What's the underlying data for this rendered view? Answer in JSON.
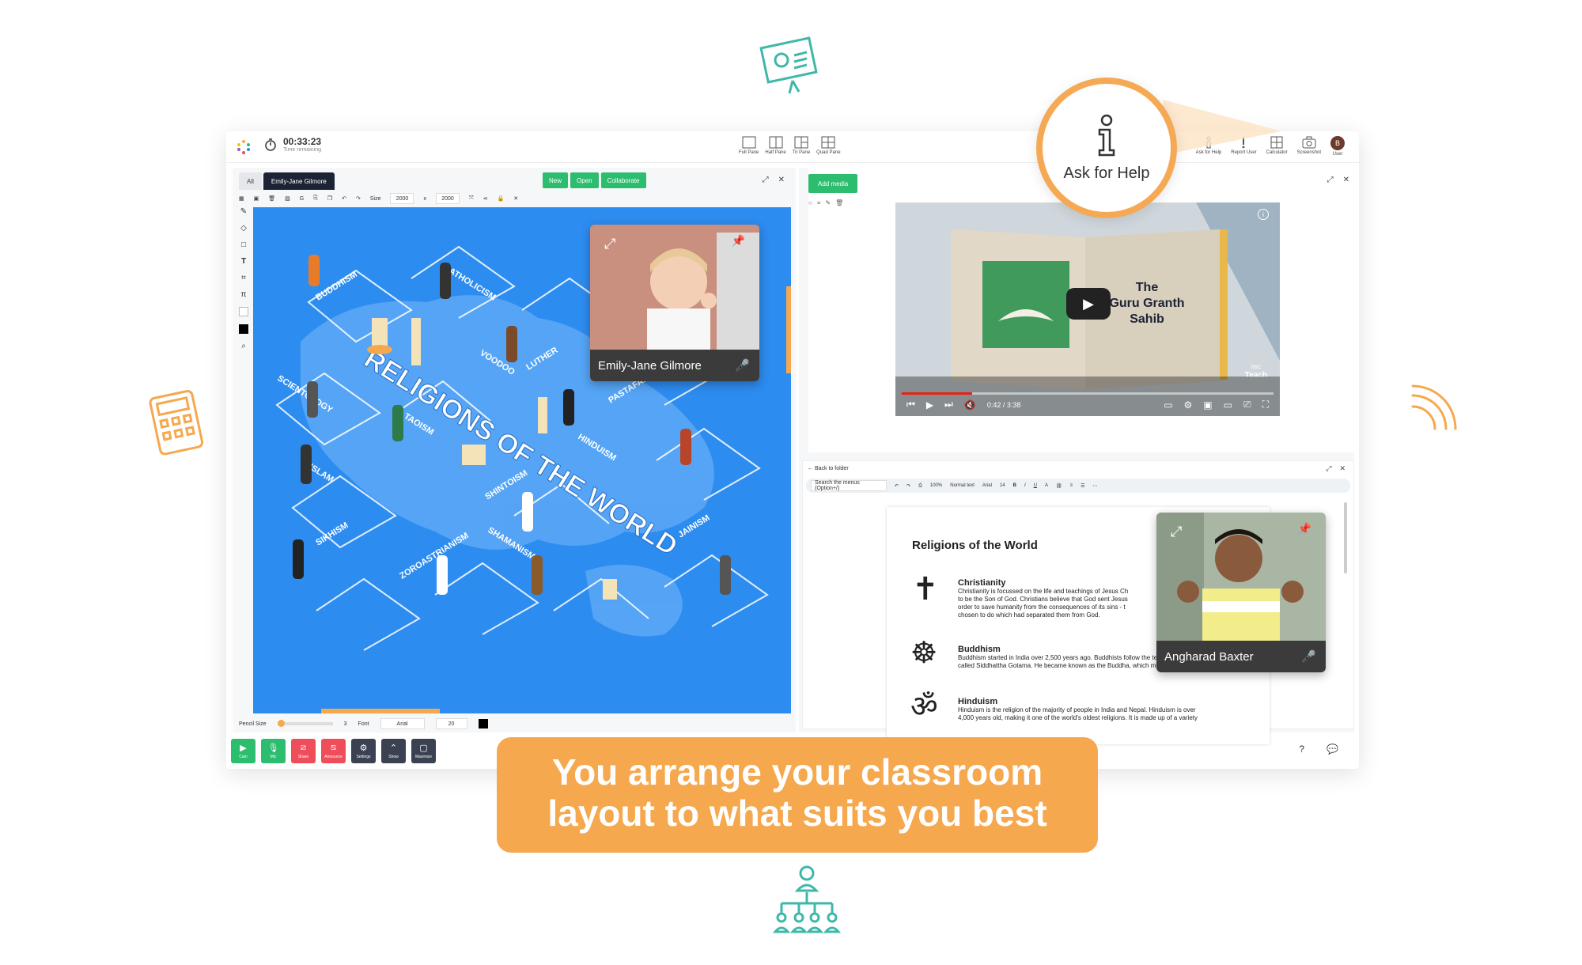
{
  "topbar": {
    "timer_value": "00:33:23",
    "timer_label": "Time remaining",
    "panes": [
      "Full Pane",
      "Half Pane",
      "Tri Pane",
      "Quad Pane"
    ],
    "tools": [
      "Ask for Help",
      "Report User",
      "Calculator",
      "Screenshot",
      "User"
    ],
    "avatar_letter": "B"
  },
  "left_panel": {
    "tabs": [
      "All",
      "Emily-Jane Gilmore"
    ],
    "buttons": {
      "new": "New",
      "open": "Open",
      "collaborate": "Collaborate"
    },
    "size_label": "Size",
    "size_w": "2000",
    "size_x": "x",
    "size_h": "2000",
    "pencil_label": "Pencil Size",
    "pencil_value": "3",
    "font_label": "Font",
    "font_value": "Arial",
    "font_size": "20",
    "canvas": {
      "title": "RELIGIONS OF THE WORLD",
      "labels": [
        "BUDDHISM",
        "CATHOLICISM",
        "VOODOO",
        "LUTHER",
        "PASTAFARIANISM",
        "SCIENTOLOGY",
        "TAOISM",
        "HINDUISM",
        "ISLAM",
        "SHINTOISM",
        "SIKHISM",
        "ZOROASTRIANISM",
        "SHAMANISM",
        "JAINISM"
      ]
    },
    "video_tile": "Emily-Jane Gilmore"
  },
  "controls": [
    "Cam",
    "Mic",
    "Share",
    "Announce",
    "Settings",
    "Show",
    "Maximize"
  ],
  "right_panel": {
    "add_media": "Add media",
    "video": {
      "title_line1": "The",
      "title_line2": "Guru Granth",
      "title_line3": "Sahib",
      "brand1": "BBC",
      "brand2": "Teach",
      "time": "0:42 / 3:38",
      "progress": 0.19
    },
    "doc": {
      "back": "Back to folder",
      "search": "Search the menus (Option+/)",
      "zoom": "100%",
      "style": "Normal text",
      "font": "Arial",
      "size": "14",
      "heading": "Religions of the World",
      "sections": [
        {
          "title": "Christianity",
          "lines": [
            "Christianity is focussed on the life and teachings of Jesus Ch",
            "to be the Son of God. Christians believe that God sent Jesus",
            "order to save humanity from the consequences of its sins - t",
            "chosen to do which had separated them from God."
          ]
        },
        {
          "title": "Buddhism",
          "lines": [
            "Buddhism started in India over 2,500 years ago.  Buddhists follow the teachings of a man",
            "called Siddhattha Gotama. He became known as the Buddha, which means 'enlightened'."
          ]
        },
        {
          "title": "Hinduism",
          "lines": [
            "Hinduism is the religion of the majority of people in India and Nepal.  Hinduism is over",
            "4,000 years old, making it one of the world's oldest religions. It is made up of a variety"
          ]
        }
      ]
    },
    "video_tile": "Angharad Baxter"
  },
  "callout": "Ask for Help",
  "banner": {
    "line1": "You arrange your classroom",
    "line2": "layout to what suits you best"
  },
  "colors": {
    "green": "#2dbd6e",
    "orange": "#f6a84e",
    "teal": "#3fb8a8",
    "canvas_blue": "#2d8cf0",
    "dark": "#1c2334",
    "red": "#ee4d5a"
  }
}
